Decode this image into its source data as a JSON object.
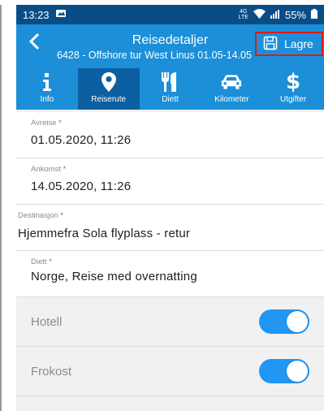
{
  "status": {
    "time": "13:23",
    "network": "4G",
    "network_sub": "LTE",
    "battery": "55%"
  },
  "header": {
    "title": "Reisedetaljer",
    "subtitle": "6428 - Offshore tur West Linus 01.05-14.05",
    "save_label": "Lagre"
  },
  "tabs": [
    {
      "label": "Info",
      "icon": "info-icon"
    },
    {
      "label": "Reiserute",
      "icon": "location-pin-icon"
    },
    {
      "label": "Diett",
      "icon": "fork-knife-icon"
    },
    {
      "label": "Kilometer",
      "icon": "car-icon"
    },
    {
      "label": "Utgifter",
      "icon": "dollar-icon"
    }
  ],
  "active_tab": "Reiserute",
  "form": {
    "avreise": {
      "label": "Avreise",
      "required": "*",
      "value": "01.05.2020, 11:26"
    },
    "ankomst": {
      "label": "Ankomst",
      "required": "*",
      "value": "14.05.2020, 11:26"
    },
    "destinasjon": {
      "label": "Destinasjon",
      "required": "*",
      "value": "Hjemmefra Sola flyplass - retur"
    },
    "diett": {
      "label": "Diett",
      "required": "*",
      "value": "Norge, Reise med overnatting"
    },
    "toggles": [
      {
        "label": "Hotell",
        "on": true
      },
      {
        "label": "Frokost",
        "on": true
      }
    ]
  },
  "colors": {
    "primary": "#1c8fd8",
    "active_tab": "#0c5fa0",
    "status_bar": "#0a4d86",
    "toggle_on": "#2196f3",
    "save_highlight": "#e01818"
  }
}
